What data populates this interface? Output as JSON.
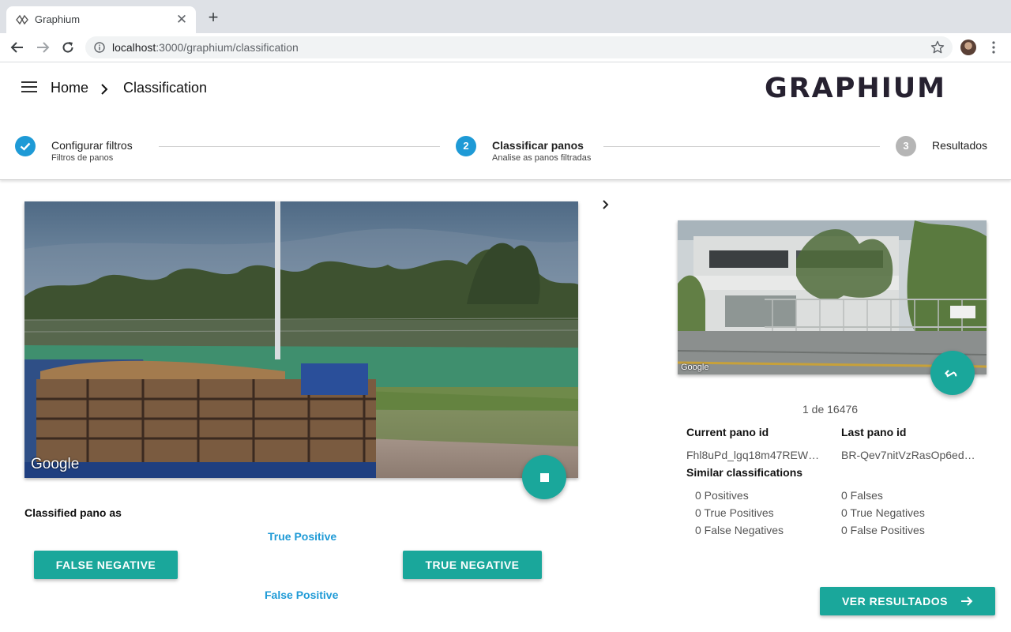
{
  "browser": {
    "tab_title": "Graphium",
    "url_host": "localhost",
    "url_path": ":3000/graphium/classification"
  },
  "header": {
    "breadcrumb_home": "Home",
    "breadcrumb_current": "Classification",
    "logo_text": "GRAPHIUM"
  },
  "stepper": {
    "steps": [
      {
        "number": "✓",
        "title": "Configurar filtros",
        "subtitle": "Filtros de panos",
        "state": "completed"
      },
      {
        "number": "2",
        "title": "Classificar panos",
        "subtitle": "Analise as panos filtradas",
        "state": "active"
      },
      {
        "number": "3",
        "title": "Resultados",
        "subtitle": "",
        "state": "pending"
      }
    ],
    "colors": {
      "active": "#1e9ad6",
      "pending": "#b5b5b5"
    }
  },
  "main_pano": {
    "watermark": "Google"
  },
  "side_panel": {
    "watermark": "Google",
    "counter": "1 de 16476",
    "current_pano_label": "Current pano id",
    "current_pano_value": "Fhl8uPd_lgq18m47REW…",
    "last_pano_label": "Last pano id",
    "last_pano_value": "BR-Qev7nitVzRasOp6ed…",
    "similar_label": "Similar classifications",
    "stats_left": [
      "0 Positives",
      "0 True Positives",
      "0 False Negatives"
    ],
    "stats_right": [
      "0 Falses",
      "0 True Negatives",
      "0 False Positives"
    ]
  },
  "classification": {
    "label": "Classified pano as",
    "true_positive": "True Positive",
    "false_positive": "False Positive",
    "false_negative": "FALSE NEGATIVE",
    "true_negative": "TRUE NEGATIVE"
  },
  "actions": {
    "ver_resultados": "VER RESULTADOS"
  },
  "colors": {
    "accent": "#1aa79b",
    "link": "#1e9ad6"
  }
}
